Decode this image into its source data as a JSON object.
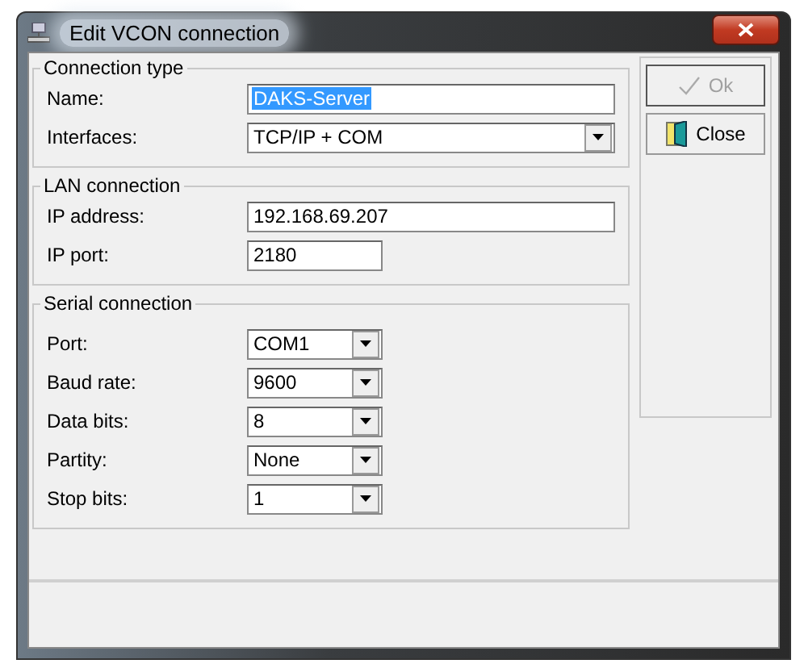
{
  "window": {
    "title": "Edit VCON connection"
  },
  "groups": [
    {
      "title": "Connection type",
      "fields": [
        {
          "label": "Name:",
          "value": "DAKS-Server",
          "kind": "text",
          "selected": true
        },
        {
          "label": "Interfaces:",
          "value": "TCP/IP + COM",
          "kind": "dropdown",
          "selected": false
        }
      ]
    },
    {
      "title": "LAN connection",
      "fields": [
        {
          "label": "IP address:",
          "value": "192.168.69.207",
          "kind": "text",
          "selected": false
        },
        {
          "label": "IP port:",
          "value": "2180",
          "kind": "text",
          "selected": false
        }
      ]
    },
    {
      "title": "Serial connection",
      "fields": [
        {
          "label": "Port:",
          "value": "COM1",
          "kind": "dropdown",
          "selected": false
        },
        {
          "label": "Baud rate:",
          "value": "9600",
          "kind": "dropdown",
          "selected": false
        },
        {
          "label": "Data bits:",
          "value": "8",
          "kind": "dropdown",
          "selected": false
        },
        {
          "label": "Partity:",
          "value": "None",
          "kind": "dropdown",
          "selected": false
        },
        {
          "label": "Stop bits:",
          "value": "1",
          "kind": "dropdown",
          "selected": false
        }
      ]
    }
  ],
  "buttons": [
    {
      "label": "Ok",
      "kind": "ok",
      "disabled": true
    },
    {
      "label": "Close",
      "kind": "close",
      "disabled": false
    }
  ]
}
